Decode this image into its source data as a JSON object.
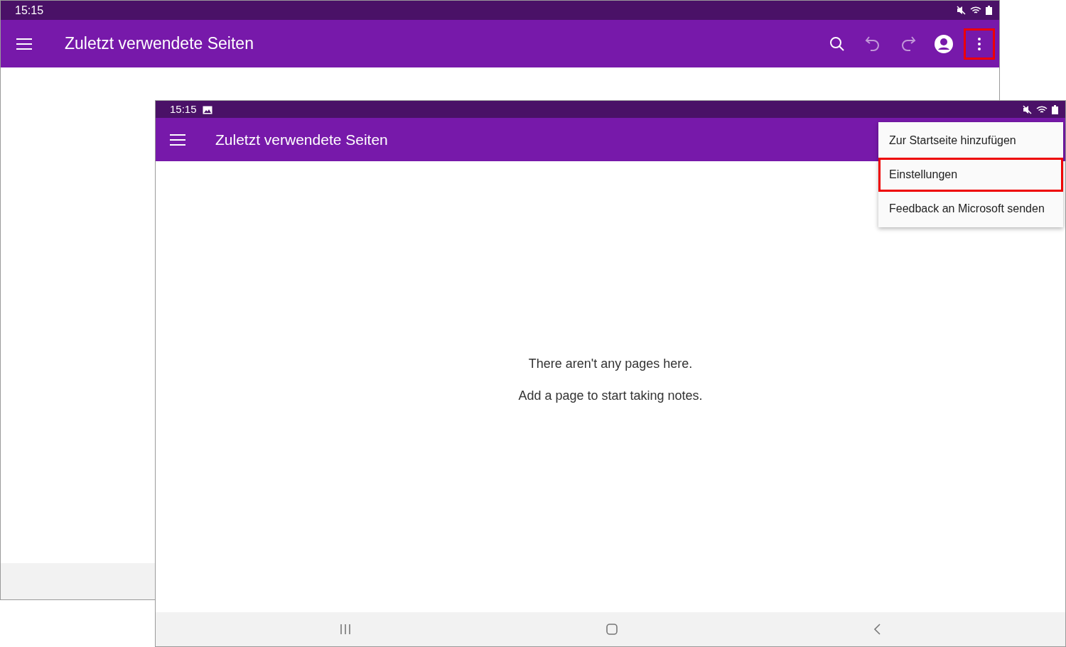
{
  "screens": [
    {
      "status_bar": {
        "time": "15:15"
      },
      "app_bar": {
        "title": "Zuletzt verwendete Seiten",
        "actions": [
          {
            "kind": "search",
            "disabled": false,
            "highlighted": false
          },
          {
            "kind": "undo",
            "disabled": true,
            "highlighted": false
          },
          {
            "kind": "redo",
            "disabled": true,
            "highlighted": false
          },
          {
            "kind": "account",
            "disabled": false,
            "highlighted": false
          },
          {
            "kind": "more",
            "disabled": false,
            "highlighted": true
          }
        ]
      }
    },
    {
      "status_bar": {
        "time": "15:15",
        "notification_icon": true
      },
      "app_bar": {
        "title": "Zuletzt verwendete Seiten"
      },
      "empty_state": [
        "There aren't any pages here.",
        "Add a page to start taking notes."
      ],
      "menu": [
        {
          "label": "Zur Startseite hinzufügen",
          "highlighted": false
        },
        {
          "label": "Einstellungen",
          "highlighted": true
        },
        {
          "label": "Feedback an Microsoft senden",
          "highlighted": false
        }
      ]
    }
  ]
}
